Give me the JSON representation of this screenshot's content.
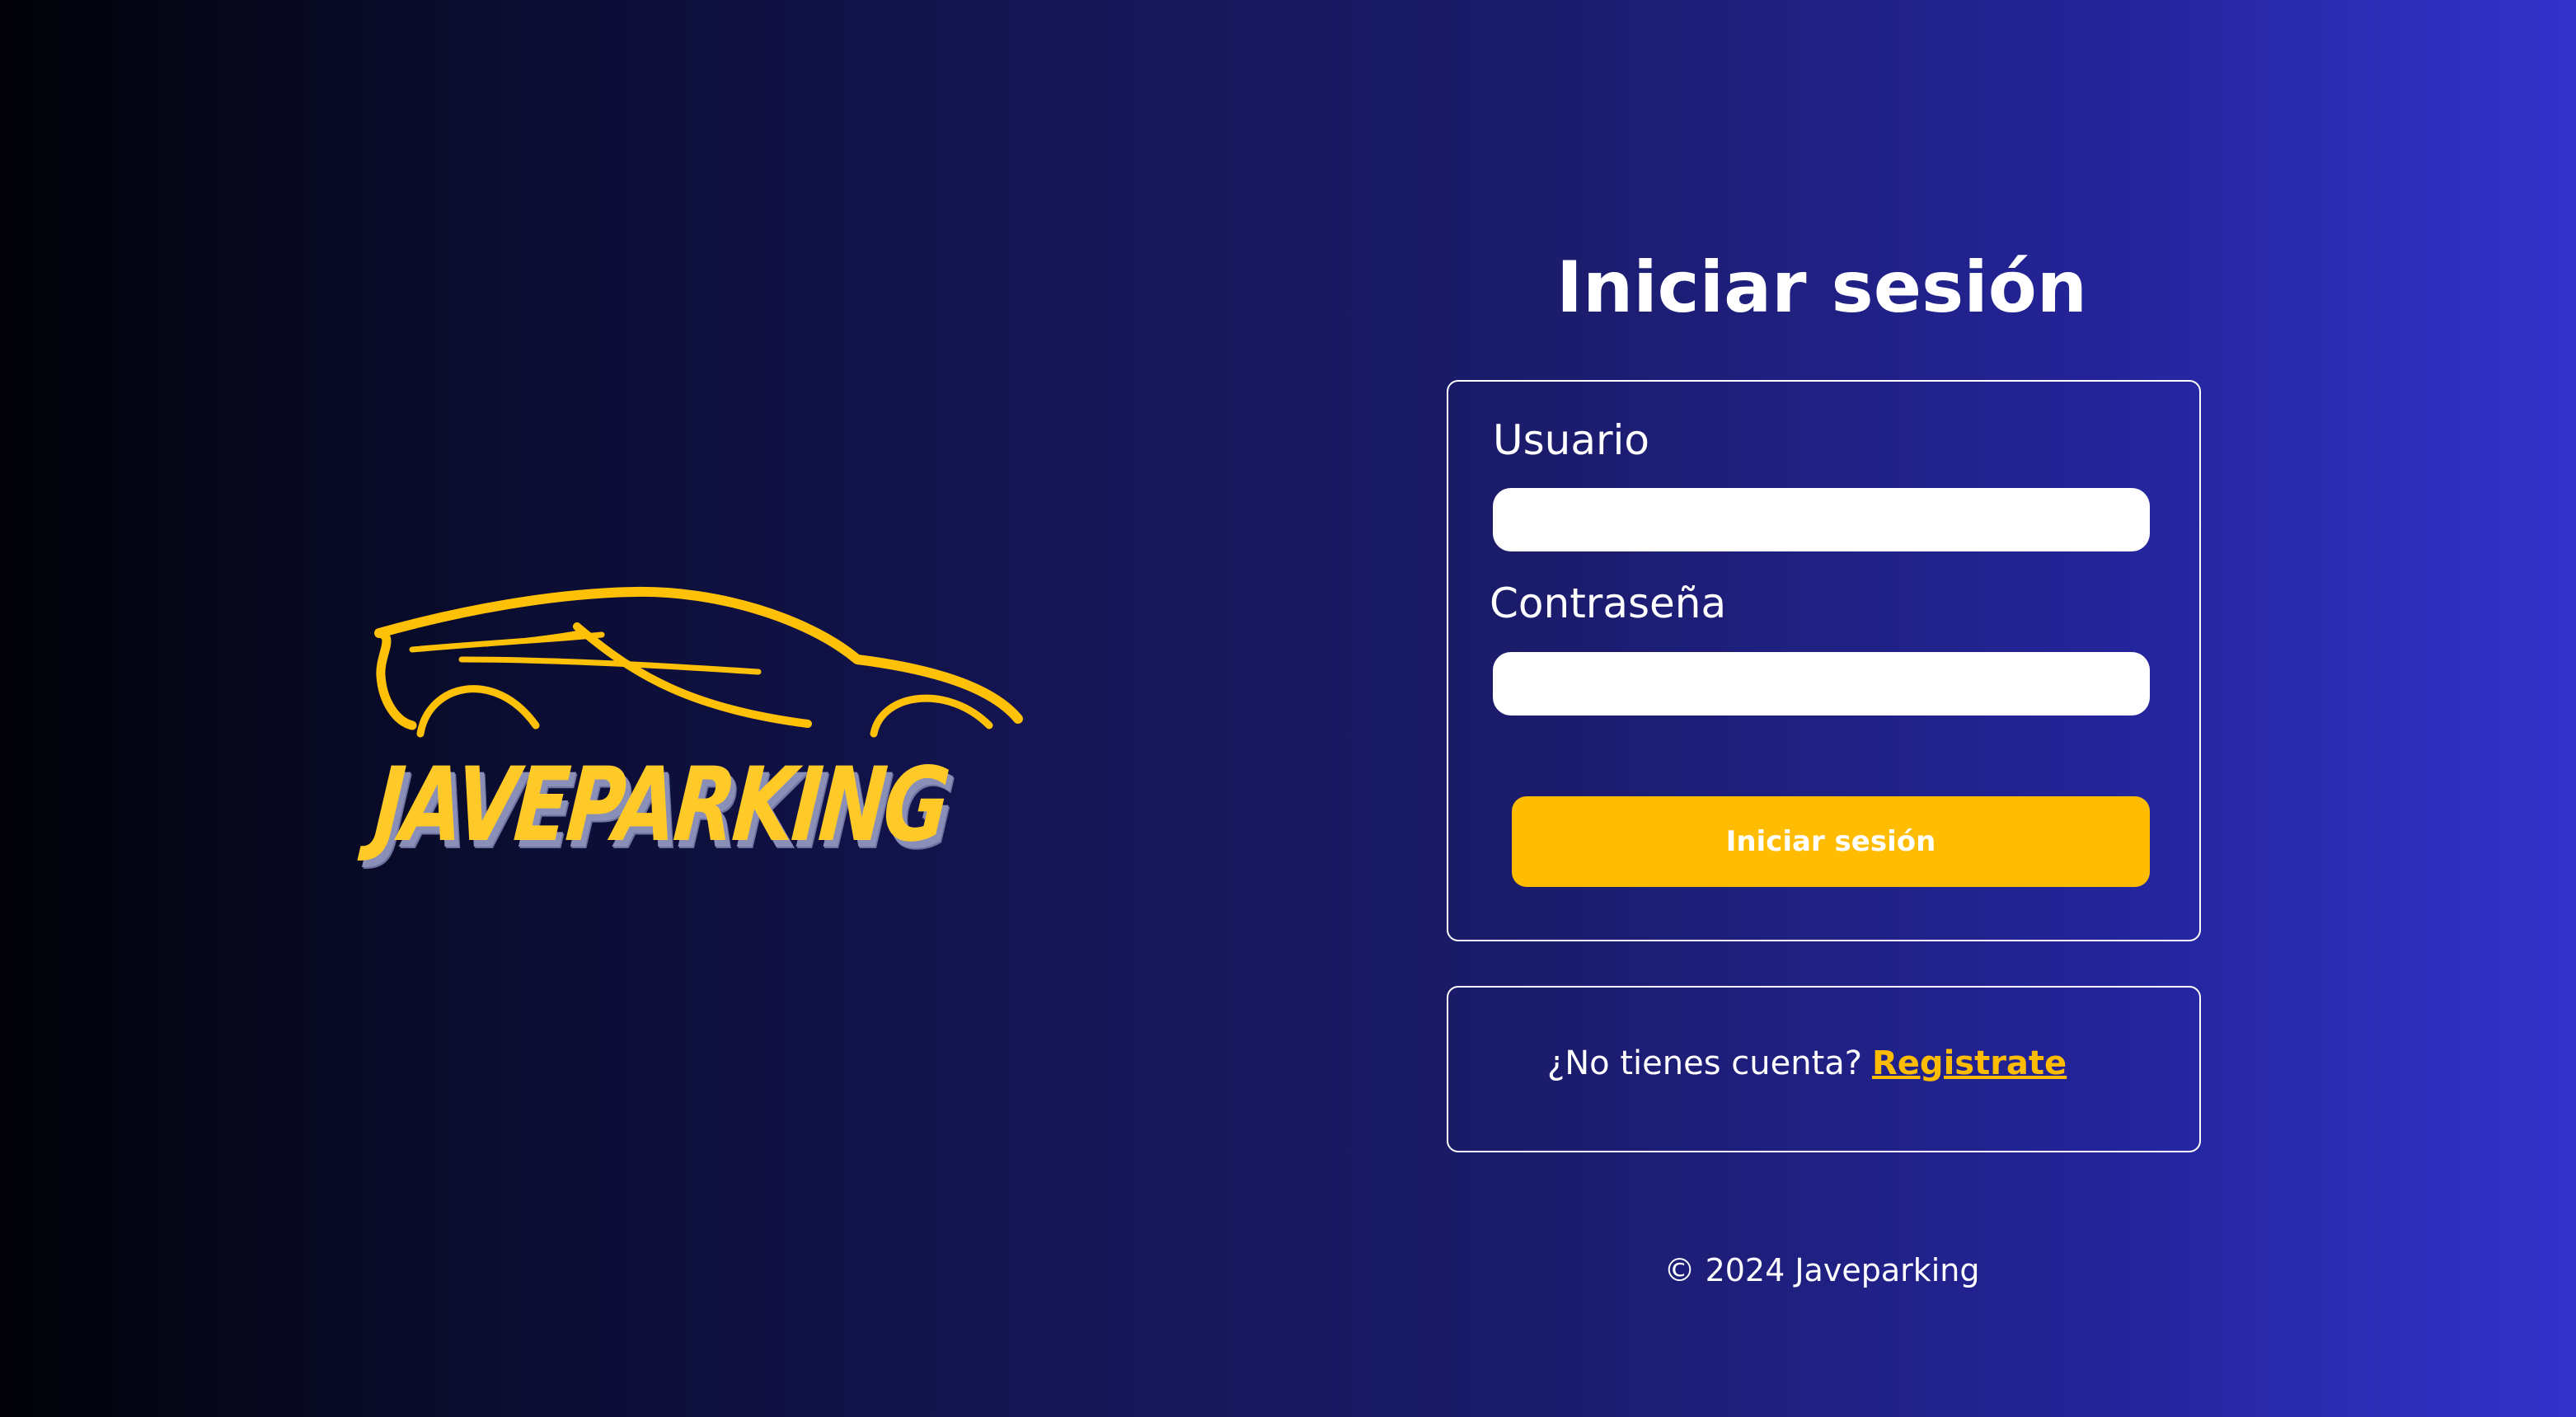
{
  "brand": {
    "logo_text": "JAVEPARKING",
    "logo_icon": "car-silhouette-icon",
    "logo_color": "#ffc107"
  },
  "login": {
    "title": "Iniciar sesión",
    "username_label": "Usuario",
    "username_value": "",
    "password_label": "Contraseña",
    "password_value": "",
    "submit_label": "Iniciar sesión"
  },
  "register": {
    "prompt": "¿No tienes cuenta?",
    "link_label": "Registrate"
  },
  "footer": {
    "text": "© 2024 Javeparking"
  },
  "colors": {
    "accent": "#ffbc00",
    "background_start": "#000000",
    "background_end": "#3333cc",
    "text": "#ffffff"
  }
}
